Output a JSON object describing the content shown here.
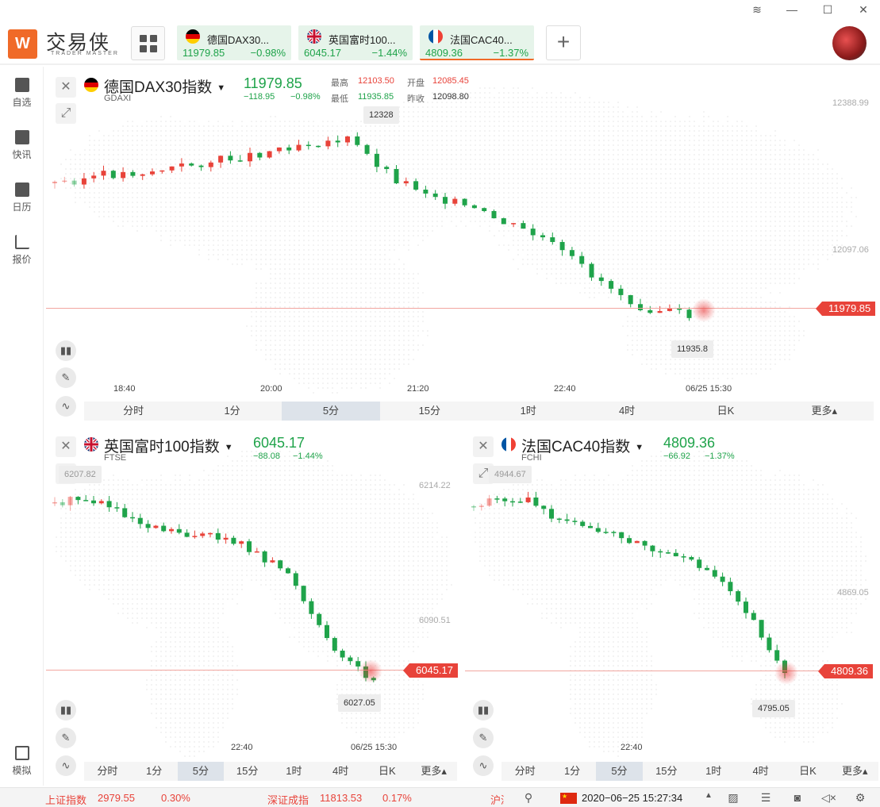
{
  "window": {
    "controls": [
      "≋",
      "—",
      "☐",
      "✕"
    ]
  },
  "brand": {
    "logo_glyph": "W",
    "name": "交易侠",
    "sub": "TRADER MASTER",
    "accent": "#f06a28"
  },
  "tabs": [
    {
      "name": "德国DAX30...",
      "price": "11979.85",
      "change": "−0.98%",
      "flag": "de"
    },
    {
      "name": "英国富时100...",
      "price": "6045.17",
      "change": "−1.44%",
      "flag": "uk"
    },
    {
      "name": "法国CAC40...",
      "price": "4809.36",
      "change": "−1.37%",
      "flag": "fr"
    }
  ],
  "sidebar": [
    {
      "label": "自选",
      "icon": "bookmark-plus-icon"
    },
    {
      "label": "快讯",
      "icon": "news-list-icon"
    },
    {
      "label": "日历",
      "icon": "calendar-icon"
    },
    {
      "label": "报价",
      "icon": "trend-line-icon"
    },
    {
      "label": "模拟",
      "icon": "wallet-icon"
    }
  ],
  "colors": {
    "up": "#e8433a",
    "down": "#1fa34a"
  },
  "panels": {
    "dax": {
      "title": "德国DAX30指数",
      "code": "GDAXI",
      "price": "11979.85",
      "change": "−118.95",
      "pct": "−0.98%",
      "stats": {
        "high_label": "最高",
        "high": "12103.50",
        "open_label": "开盘",
        "open": "12085.45",
        "low_label": "最低",
        "low": "11935.85",
        "prev_label": "昨收",
        "prev": "12098.80"
      },
      "axis_right": [
        "12388.99",
        "12097.06"
      ],
      "axis_x": [
        "18:40",
        "20:00",
        "21:20",
        "22:40",
        "06/25 15:30"
      ],
      "last_tag": "11979.85",
      "high_tag": "12328",
      "low_tag": "11935.8",
      "timeframes": [
        "分时",
        "1分",
        "5分",
        "15分",
        "1时",
        "4时",
        "日K",
        "更多▴"
      ],
      "selected": 2
    },
    "ftse": {
      "title": "英国富时100指数",
      "code": "FTSE",
      "price": "6045.17",
      "change": "−88.08",
      "pct": "−1.44%",
      "axis_right": [
        "6214.22",
        "6090.51"
      ],
      "axis_x": [
        "22:40",
        "06/25 15:30"
      ],
      "last_tag": "6045.17",
      "high_tag": "6207.82",
      "low_tag": "6027.05",
      "timeframes": [
        "分时",
        "1分",
        "5分",
        "15分",
        "1时",
        "4时",
        "日K",
        "更多▴"
      ],
      "selected": 2
    },
    "cac": {
      "title": "法国CAC40指数",
      "code": "FCHI",
      "price": "4809.36",
      "change": "−66.92",
      "pct": "−1.37%",
      "axis_right": [
        "4869.05"
      ],
      "axis_x": [
        "22:40"
      ],
      "last_tag": "4809.36",
      "high_tag": "4944.67",
      "low_tag": "4795.05",
      "timeframes": [
        "分时",
        "1分",
        "5分",
        "15分",
        "1时",
        "4时",
        "日K",
        "更多▴"
      ],
      "selected": 2
    }
  },
  "status": {
    "sh_label": "上证指数",
    "sh_value": "2979.55",
    "sh_pct": "0.30%",
    "sz_label": "深证成指",
    "sz_value": "11813.53",
    "sz_pct": "0.17%",
    "more": "沪深",
    "datetime": "2020−06−25 15:27:34"
  }
}
